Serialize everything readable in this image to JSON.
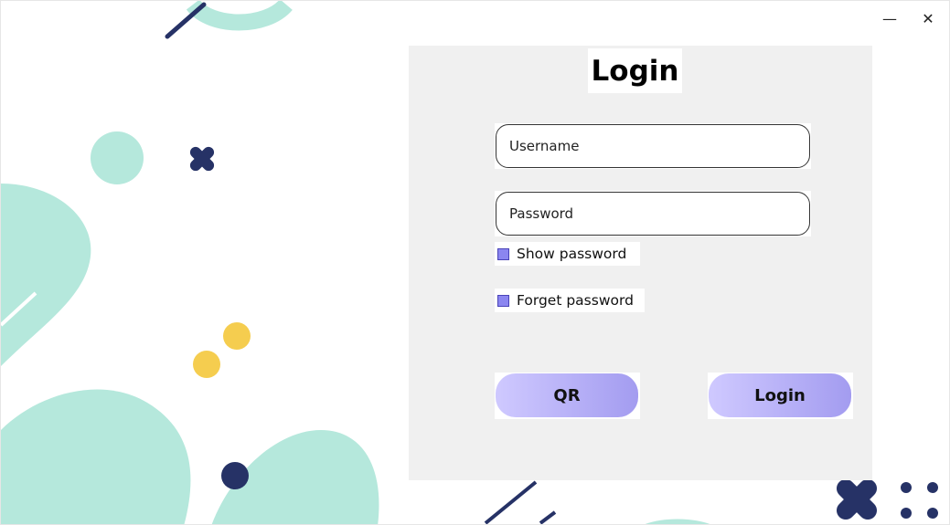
{
  "window": {
    "minimize_glyph": "—",
    "close_glyph": "✕"
  },
  "login": {
    "title": "Login",
    "username_placeholder": "Username",
    "password_placeholder": "Password",
    "show_password_label": "Show password",
    "forget_password_label": "Forget password",
    "qr_label": "QR",
    "login_label": "Login"
  },
  "colors": {
    "mint": "#b5e8dc",
    "navy": "#263266",
    "yellow": "#f5cd4f",
    "button_gradient_start": "#cfc9ff",
    "button_gradient_end": "#a39cf0",
    "panel": "#f0f0f0"
  }
}
